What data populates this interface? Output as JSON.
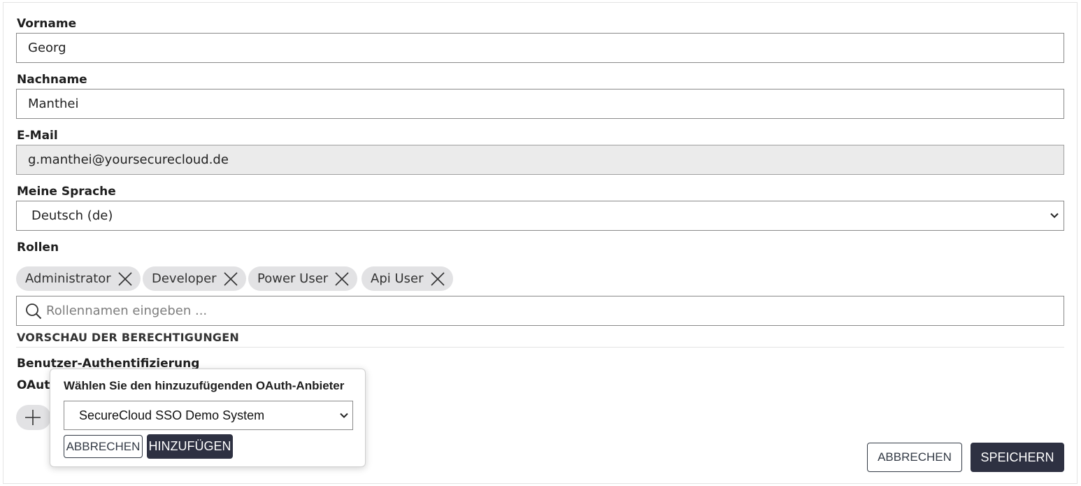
{
  "form": {
    "firstname_label": "Vorname",
    "firstname_value": "Georg",
    "lastname_label": "Nachname",
    "lastname_value": "Manthei",
    "email_label": "E-Mail",
    "email_value": "g.manthei@yoursecurecloud.de",
    "language_label": "Meine Sprache",
    "language_value": "Deutsch (de)",
    "roles_label": "Rollen",
    "roles": [
      {
        "label": "Administrator"
      },
      {
        "label": "Developer"
      },
      {
        "label": "Power User"
      },
      {
        "label": "Api User"
      }
    ],
    "role_search_placeholder": "Rollennamen eingeben ...",
    "permissions_preview_title": "VORSCHAU DER BERECHTIGUNGEN",
    "auth_section_label": "Benutzer-Authentifizierung",
    "oauth_label_visible": "OAuth"
  },
  "popup": {
    "title": "Wählen Sie den hinzuzufügenden OAuth-Anbieter",
    "selected_provider": "SecureCloud SSO Demo System",
    "cancel_label": "ABBRECHEN",
    "add_label": "HINZUFÜGEN"
  },
  "footer": {
    "cancel_label": "ABBRECHEN",
    "save_label": "SPEICHERN"
  },
  "colors": {
    "primary_button": "#2e3142",
    "chip_bg": "#e2e2e4",
    "readonly_bg": "#ebebeb"
  },
  "icons": [
    "chevron-down-icon",
    "close-icon",
    "search-icon",
    "plus-icon"
  ]
}
